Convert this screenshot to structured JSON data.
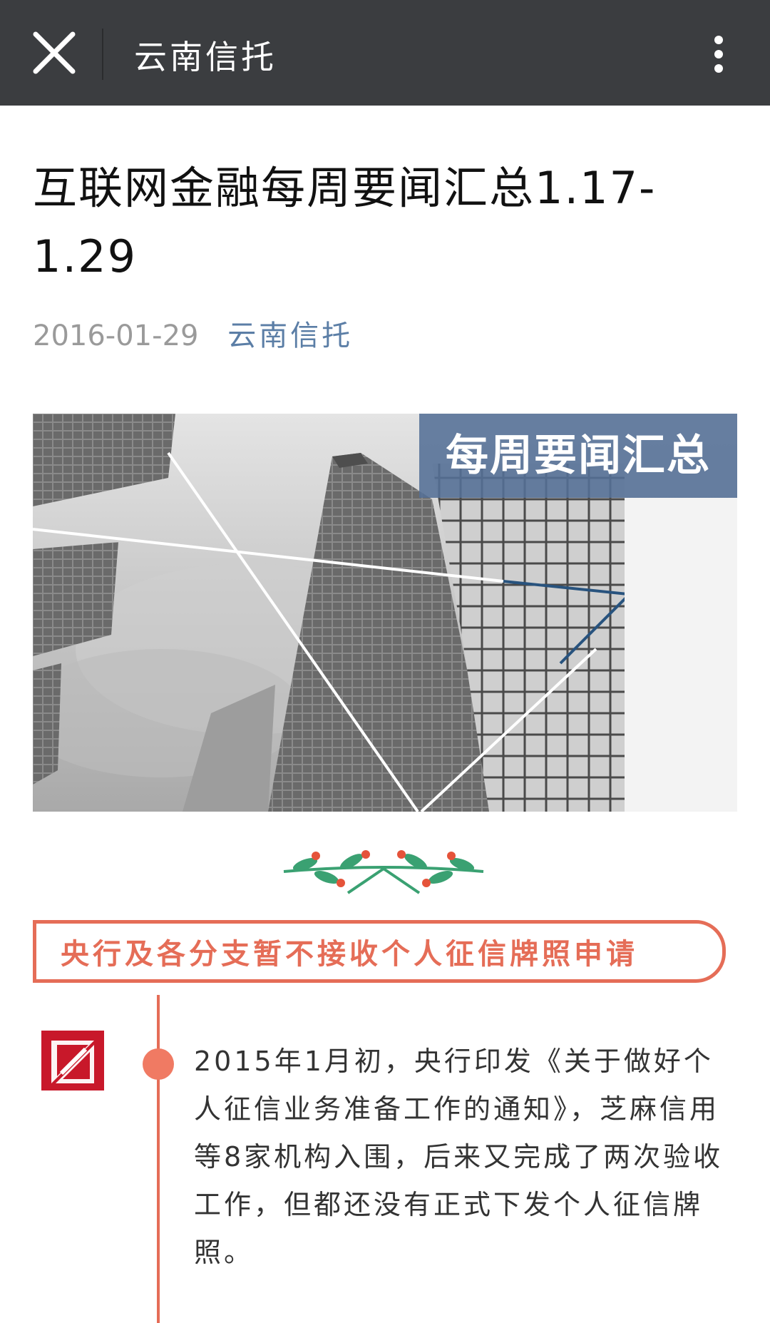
{
  "topbar": {
    "title": "云南信托",
    "close_icon": "close-icon",
    "more_icon": "more-vertical-icon",
    "background_color": "#3b3d40"
  },
  "article": {
    "title": "互联网金融每周要闻汇总1.17-1.29",
    "date": "2016-01-29",
    "account": "云南信托",
    "account_color": "#5b7ea6"
  },
  "cover": {
    "label": "每周要闻汇总",
    "label_color": "#547096"
  },
  "decoration": {
    "icon": "leaf-sprig-divider"
  },
  "section": {
    "headline": "央行及各分支暂不接收个人征信牌照申请",
    "accent_color": "#e56d57",
    "logo_icon": "logo-icon",
    "paragraph": "2015年1月初，央行印发《关于做好个人征信业务准备工作的通知》，芝麻信用等8家机构入围，后来又完成了两次验收工作，但都还没有正式下发个人征信牌照。"
  }
}
